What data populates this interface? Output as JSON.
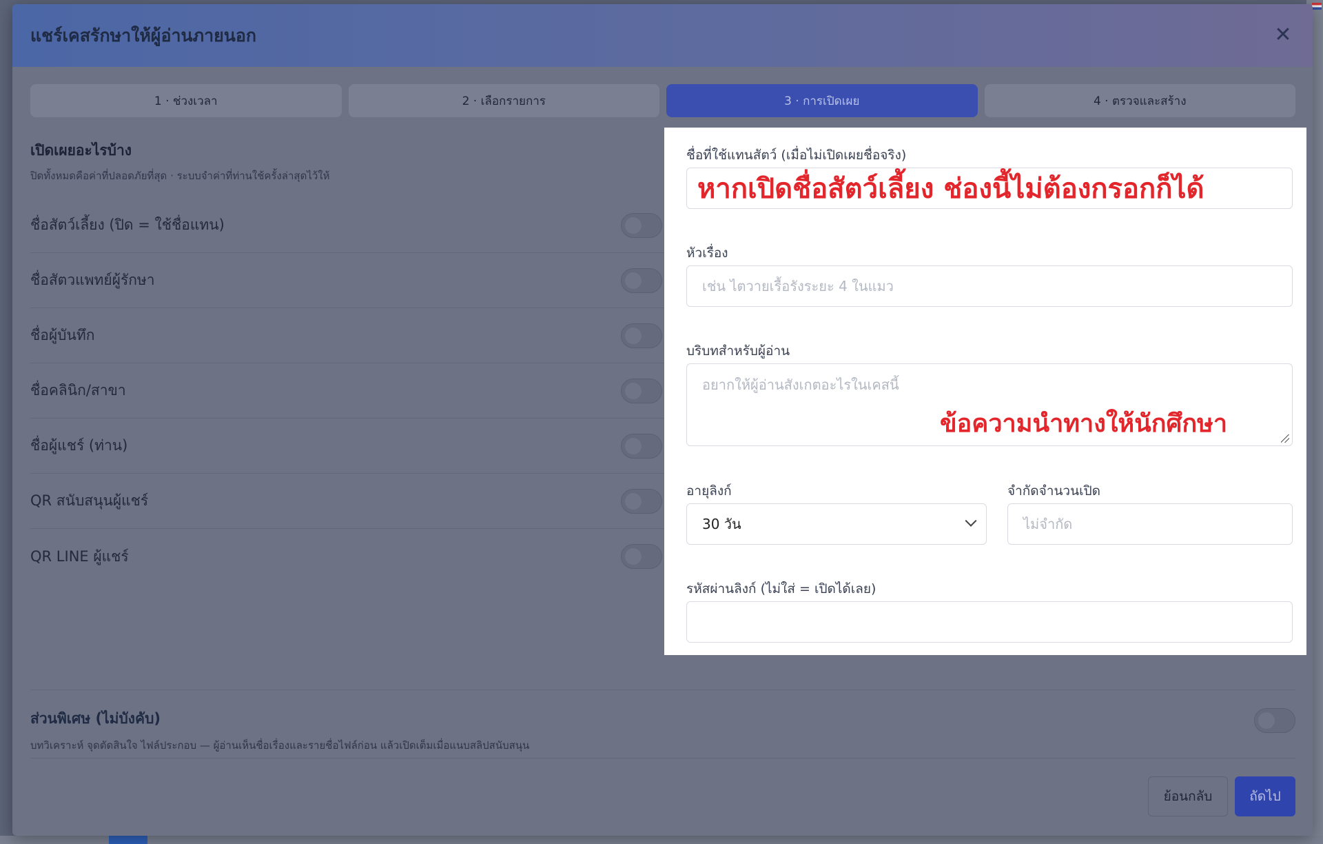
{
  "dialog": {
    "title": "แชร์เคสรักษาให้ผู้อ่านภายนอก",
    "close_glyph": "✕"
  },
  "steps": [
    {
      "label": "1 · ช่วงเวลา",
      "active": false
    },
    {
      "label": "2 · เลือกรายการ",
      "active": false
    },
    {
      "label": "3 · การเปิดเผย",
      "active": true
    },
    {
      "label": "4 · ตรวจและสร้าง",
      "active": false
    }
  ],
  "disclosure": {
    "title": "เปิดเผยอะไรบ้าง",
    "subtitle": "ปิดทั้งหมดคือค่าที่ปลอดภัยที่สุด · ระบบจำค่าที่ท่านใช้ครั้งล่าสุดไว้ให้",
    "toggles": [
      {
        "label": "ชื่อสัตว์เลี้ยง (ปิด = ใช้ชื่อแทน)",
        "on": false
      },
      {
        "label": "ชื่อสัตวแพทย์ผู้รักษา",
        "on": false
      },
      {
        "label": "ชื่อผู้บันทึก",
        "on": false
      },
      {
        "label": "ชื่อคลินิก/สาขา",
        "on": false
      },
      {
        "label": "ชื่อผู้แชร์ (ท่าน)",
        "on": false
      },
      {
        "label": "QR สนับสนุนผู้แชร์",
        "on": false
      },
      {
        "label": "QR LINE ผู้แชร์",
        "on": false
      }
    ]
  },
  "form": {
    "alias": {
      "label": "ชื่อที่ใช้แทนสัตว์ (เมื่อไม่เปิดเผยชื่อจริง)",
      "value": ""
    },
    "topic": {
      "label": "หัวเรื่อง",
      "placeholder": "เช่น ไตวายเรื้อรังระยะ 4 ในแมว"
    },
    "context": {
      "label": "บริบทสำหรับผู้อ่าน",
      "placeholder": "อยากให้ผู้อ่านสังเกตอะไรในเคสนี้"
    },
    "link_age": {
      "label": "อายุลิงก์",
      "value": "30 วัน"
    },
    "open_limit": {
      "label": "จำกัดจำนวนเปิด",
      "placeholder": "ไม่จำกัด"
    },
    "password": {
      "label": "รหัสผ่านลิงก์ (ไม่ใส่ = เปิดได้เลย)",
      "value": ""
    }
  },
  "annotations": {
    "alias_note": "หากเปิดชื่อสัตว์เลี้ยง ช่องนี้ไม่ต้องกรอกก็ได้",
    "context_note": "ข้อความนำทางให้นักศึกษา",
    "color": "#e2262b"
  },
  "optional": {
    "title": "ส่วนพิเศษ (ไม่บังคับ)",
    "subtitle": "บทวิเคราะห์ จุดตัดสินใจ ไฟล์ประกอบ — ผู้อ่านเห็นชื่อเรื่องและรายชื่อไฟล์ก่อน แล้วเปิดเต็มเมื่อแนบสลิปสนับสนุน",
    "on": false
  },
  "footer": {
    "back_label": "ย้อนกลับ",
    "next_label": "ถัดไป"
  },
  "colors": {
    "accent": "#3a4fb0",
    "overlay_bg": "#6d7384",
    "annotation": "#e2262b"
  }
}
